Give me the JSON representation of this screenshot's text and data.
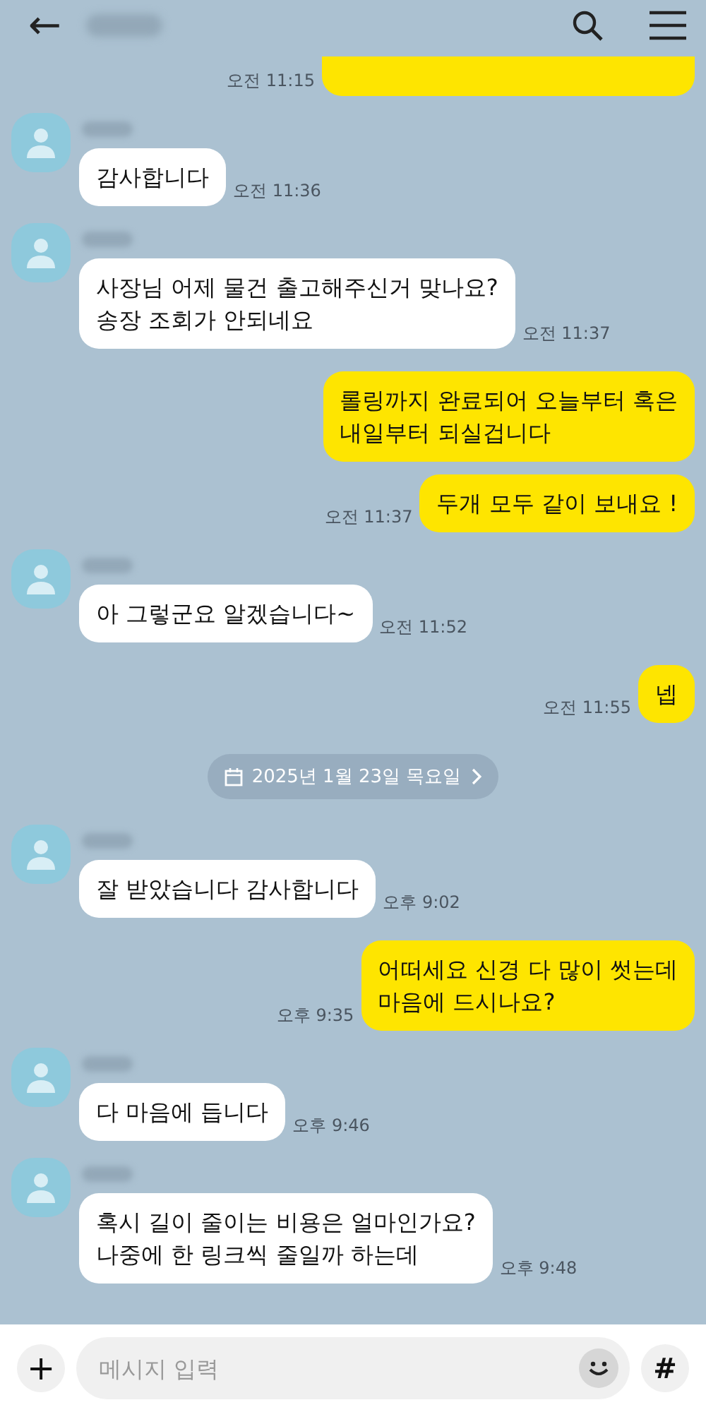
{
  "header": {
    "back": "←"
  },
  "items": [
    {
      "kind": "sent_clipped",
      "time": "오전 11:15"
    },
    {
      "kind": "received",
      "lines": [
        "감사합니다"
      ],
      "time": "오전 11:36"
    },
    {
      "kind": "received",
      "lines": [
        "사장님 어제 물건 출고해주신거 맞나요?",
        "송장 조회가 안되네요"
      ],
      "time": "오전 11:37"
    },
    {
      "kind": "sent",
      "lines": [
        "롤링까지 완료되어 오늘부터 혹은",
        "내일부터 되실겁니다"
      ]
    },
    {
      "kind": "sent",
      "lines": [
        "두개 모두 같이 보내요 !"
      ],
      "time": "오전 11:37"
    },
    {
      "kind": "received",
      "lines": [
        "아 그렇군요 알겠습니다~"
      ],
      "time": "오전 11:52"
    },
    {
      "kind": "sent",
      "lines": [
        "넵"
      ],
      "time": "오전 11:55"
    },
    {
      "kind": "date",
      "text": "2025년 1월 23일 목요일"
    },
    {
      "kind": "received",
      "lines": [
        "잘 받았습니다 감사합니다"
      ],
      "time": "오후 9:02"
    },
    {
      "kind": "sent",
      "lines": [
        "어떠세요 신경 다 많이 썻는데",
        "마음에 드시나요?"
      ],
      "time": "오후 9:35"
    },
    {
      "kind": "received",
      "lines": [
        "다 마음에 듭니다"
      ],
      "time": "오후 9:46"
    },
    {
      "kind": "received",
      "lines": [
        "혹시 길이 줄이는 비용은 얼마인가요?",
        "나중에 한 링크씩 줄일까 하는데"
      ],
      "time": "오후 9:48"
    }
  ],
  "input": {
    "placeholder": "메시지 입력",
    "plus": "+",
    "hash": "#"
  }
}
